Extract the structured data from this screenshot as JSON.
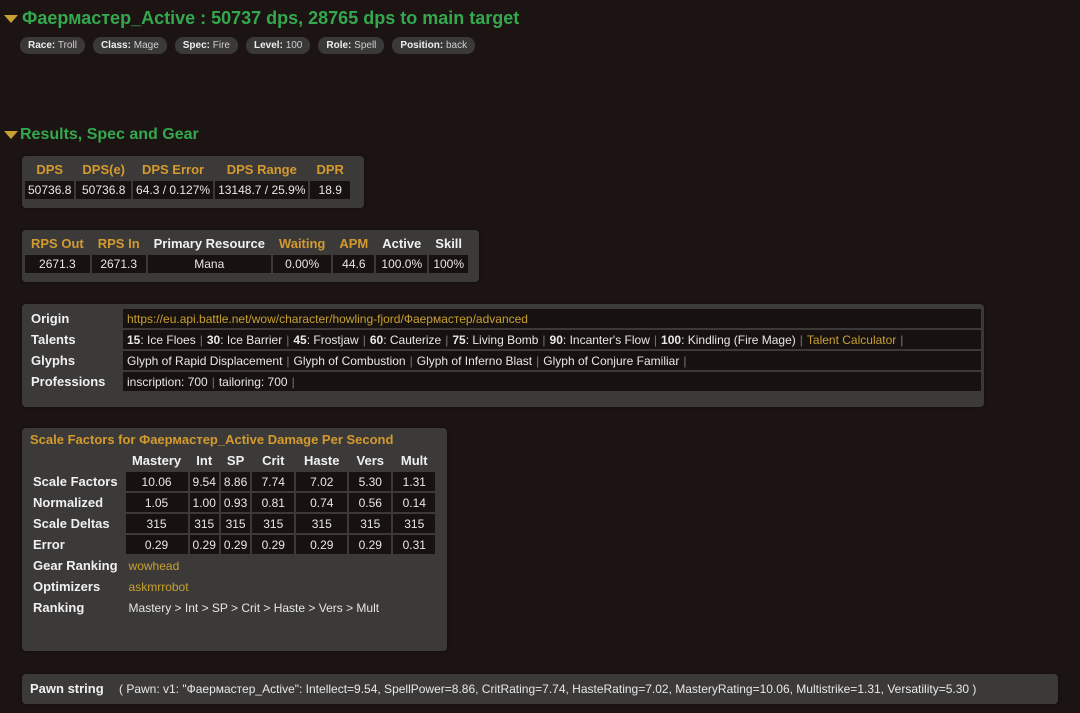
{
  "header": {
    "title": "Фаермастер_Active : 50737 dps, 28765 dps to main target",
    "tags": [
      {
        "key": "Race:",
        "value": "Troll"
      },
      {
        "key": "Class:",
        "value": "Mage"
      },
      {
        "key": "Spec:",
        "value": "Fire"
      },
      {
        "key": "Level:",
        "value": "100"
      },
      {
        "key": "Role:",
        "value": "Spell"
      },
      {
        "key": "Position:",
        "value": "back"
      }
    ]
  },
  "section": {
    "title": "Results, Spec and Gear"
  },
  "dps_table": {
    "headers": [
      "DPS",
      "DPS(e)",
      "DPS Error",
      "DPS Range",
      "DPR"
    ],
    "values": [
      "50736.8",
      "50736.8",
      "64.3 / 0.127%",
      "13148.7 / 25.9%",
      "18.9"
    ]
  },
  "rps_table": {
    "headers": [
      "RPS Out",
      "RPS In",
      "Primary Resource",
      "Waiting",
      "APM",
      "Active",
      "Skill"
    ],
    "values": [
      "2671.3",
      "2671.3",
      "Mana",
      "0.00%",
      "44.6",
      "100.0%",
      "100%"
    ]
  },
  "info": {
    "origin_label": "Origin",
    "origin_url": "https://eu.api.battle.net/wow/character/howling-fjord/Фаермастер/advanced",
    "talents_label": "Talents",
    "talents": [
      {
        "level": "15",
        "name": ": Ice Floes"
      },
      {
        "level": "30",
        "name": ": Ice Barrier"
      },
      {
        "level": "45",
        "name": ": Frostjaw"
      },
      {
        "level": "60",
        "name": ": Cauterize"
      },
      {
        "level": "75",
        "name": ": Living Bomb"
      },
      {
        "level": "90",
        "name": ": Incanter's Flow"
      },
      {
        "level": "100",
        "name": ": Kindling (Fire Mage)"
      }
    ],
    "talent_calculator": "Talent Calculator",
    "glyphs_label": "Glyphs",
    "glyphs": [
      "Glyph of Rapid Displacement",
      "Glyph of Combustion",
      "Glyph of Inferno Blast",
      "Glyph of Conjure Familiar"
    ],
    "professions_label": "Professions",
    "professions": [
      "inscription: 700",
      "tailoring: 700"
    ]
  },
  "scale": {
    "title": "Scale Factors for Фаермастер_Active Damage Per Second",
    "columns": [
      "Mastery",
      "Int",
      "SP",
      "Crit",
      "Haste",
      "Vers",
      "Mult"
    ],
    "rows": [
      {
        "label": "Scale Factors",
        "values": [
          "10.06",
          "9.54",
          "8.86",
          "7.74",
          "7.02",
          "5.30",
          "1.31"
        ]
      },
      {
        "label": "Normalized",
        "values": [
          "1.05",
          "1.00",
          "0.93",
          "0.81",
          "0.74",
          "0.56",
          "0.14"
        ]
      },
      {
        "label": "Scale Deltas",
        "values": [
          "315",
          "315",
          "315",
          "315",
          "315",
          "315",
          "315"
        ]
      },
      {
        "label": "Error",
        "values": [
          "0.29",
          "0.29",
          "0.29",
          "0.29",
          "0.29",
          "0.29",
          "0.31"
        ]
      }
    ],
    "gear_ranking_label": "Gear Ranking",
    "gear_ranking_link": "wowhead",
    "optimizers_label": "Optimizers",
    "optimizers_link": "askmrrobot",
    "ranking_label": "Ranking",
    "ranking_value": "Mastery > Int > SP > Crit > Haste > Vers > Mult"
  },
  "pawn": {
    "label": "Pawn string",
    "value": "( Pawn: v1: \"Фаермастер_Active\": Intellect=9.54, SpellPower=8.86, CritRating=7.74, HasteRating=7.02, MasteryRating=10.06, Multistrike=1.31, Versatility=5.30 )"
  },
  "colors": {
    "title_green": "#34a84e",
    "gold": "#d49a2e",
    "background": "#1c1412",
    "panel": "#3b3a39"
  }
}
